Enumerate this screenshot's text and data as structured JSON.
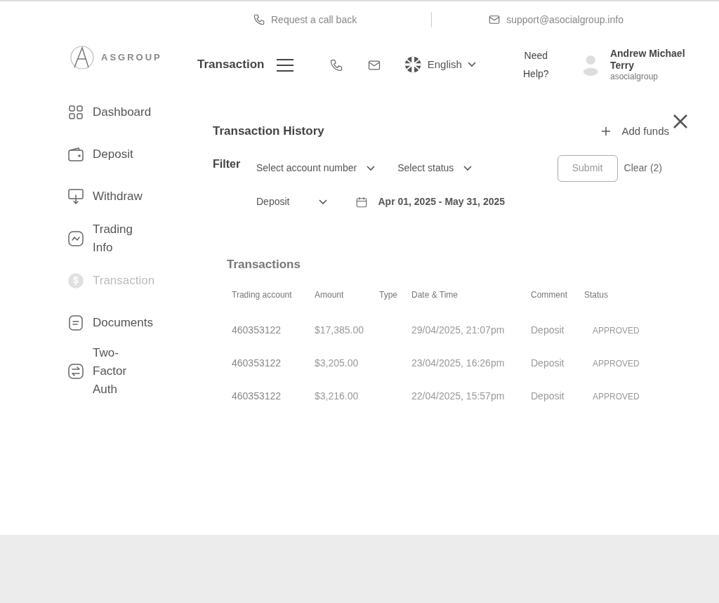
{
  "top_bar": {
    "callback": "Request a call back",
    "email": "support@asocialgroup.info"
  },
  "logo": {
    "text": "ASGROUP"
  },
  "header": {
    "title": "Transaction",
    "language": "English",
    "help": "Need Help?",
    "user": {
      "name": "Andrew Michael Terry",
      "company": "asocialgroup"
    }
  },
  "sidebar": {
    "items": [
      {
        "label": "Dashboard",
        "selected": false
      },
      {
        "label": "Deposit",
        "selected": false
      },
      {
        "label": "Withdraw",
        "selected": false
      },
      {
        "label": "Trading Info",
        "selected": false
      },
      {
        "label": "Transaction",
        "selected": true
      },
      {
        "label": "Documents",
        "selected": false
      },
      {
        "label": "Two-Factor Auth",
        "selected": false
      }
    ]
  },
  "panel": {
    "title": "Transaction History",
    "add_funds": "Add funds",
    "filter_label": "Filter",
    "filters": {
      "account": "Select account number",
      "status": "Select status",
      "type": "Deposit",
      "date_range": "Apr 01, 2025 - May 31, 2025"
    },
    "submit": "Submit",
    "clear": "Clear (2)"
  },
  "table": {
    "title": "Transactions",
    "columns": [
      "Trading account",
      "Amount",
      "Type",
      "Date & Time",
      "Comment",
      "Status"
    ],
    "rows": [
      [
        "460353122",
        "$17,385.00",
        "",
        "29/04/2025, 21:07pm",
        "Deposit",
        "APPROVED"
      ],
      [
        "460353122",
        "$3,205.00",
        "",
        "23/04/2025, 16:26pm",
        "Deposit",
        "APPROVED"
      ],
      [
        "460353122",
        "$3,216.00",
        "",
        "22/04/2025, 15:57pm",
        "Deposit",
        "APPROVED"
      ]
    ]
  }
}
